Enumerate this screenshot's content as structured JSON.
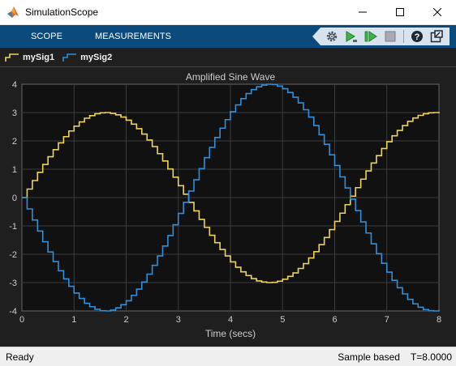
{
  "window": {
    "title": "SimulationScope"
  },
  "toolstrip": {
    "tabs": [
      {
        "label": "SCOPE"
      },
      {
        "label": "MEASUREMENTS"
      }
    ],
    "icons": [
      "settings-icon",
      "step-forward-icon",
      "run-icon",
      "stop-icon",
      "help-icon",
      "undock-icon"
    ]
  },
  "legend": {
    "items": [
      {
        "label": "mySig1",
        "color": "#edd458"
      },
      {
        "label": "mySig2",
        "color": "#2e8fdc"
      }
    ]
  },
  "chart_data": {
    "type": "line",
    "title": "Amplified Sine Wave",
    "xlabel": "Time (secs)",
    "ylabel": "",
    "xlim": [
      0,
      8
    ],
    "ylim": [
      -4,
      4
    ],
    "x_ticks": [
      "0",
      "1",
      "2",
      "3",
      "4",
      "5",
      "6",
      "7",
      "8"
    ],
    "y_ticks": [
      "4",
      "3",
      "2",
      "1",
      "0",
      "-1",
      "-2",
      "-3",
      "-4"
    ],
    "grid": true,
    "step": true,
    "sample_time": 0.1,
    "series": [
      {
        "name": "mySig1",
        "color": "#edd458",
        "x": [
          0,
          0.1,
          0.2,
          0.3,
          0.4,
          0.5,
          0.6,
          0.7,
          0.8,
          0.9,
          1,
          1.1,
          1.2,
          1.3,
          1.4,
          1.5,
          1.6,
          1.7,
          1.8,
          1.9,
          2,
          2.1,
          2.2,
          2.3,
          2.4,
          2.5,
          2.6,
          2.7,
          2.8,
          2.9,
          3,
          3.1,
          3.2,
          3.3,
          3.4,
          3.5,
          3.6,
          3.7,
          3.8,
          3.9,
          4,
          4.1,
          4.2,
          4.3,
          4.4,
          4.5,
          4.6,
          4.7,
          4.8,
          4.9,
          5,
          5.1,
          5.2,
          5.3,
          5.4,
          5.5,
          5.6,
          5.7,
          5.8,
          5.9,
          6,
          6.1,
          6.2,
          6.3,
          6.4,
          6.5,
          6.6,
          6.7,
          6.8,
          6.9,
          7,
          7.1,
          7.2,
          7.3,
          7.4,
          7.5,
          7.6,
          7.7,
          7.8,
          7.9,
          8
        ],
        "y": [
          0,
          0.3,
          0.6,
          0.89,
          1.17,
          1.44,
          1.69,
          1.93,
          2.15,
          2.35,
          2.52,
          2.67,
          2.8,
          2.89,
          2.96,
          2.99,
          3,
          2.97,
          2.92,
          2.84,
          2.73,
          2.59,
          2.43,
          2.24,
          2.03,
          1.8,
          1.55,
          1.29,
          1.01,
          0.72,
          0.42,
          0.12,
          -0.17,
          -0.47,
          -0.77,
          -1.05,
          -1.33,
          -1.59,
          -1.83,
          -2.06,
          -2.27,
          -2.46,
          -2.62,
          -2.75,
          -2.86,
          -2.94,
          -2.98,
          -3,
          -2.99,
          -2.95,
          -2.88,
          -2.78,
          -2.66,
          -2.5,
          -2.33,
          -2.13,
          -1.91,
          -1.66,
          -1.41,
          -1.13,
          -0.84,
          -0.55,
          -0.25,
          0.05,
          0.35,
          0.65,
          0.94,
          1.22,
          1.48,
          1.73,
          1.97,
          2.18,
          2.37,
          2.54,
          2.69,
          2.81,
          2.9,
          2.96,
          2.99,
          3,
          2.97
        ]
      },
      {
        "name": "mySig2",
        "color": "#2e8fdc",
        "x": [
          0,
          0.1,
          0.2,
          0.3,
          0.4,
          0.5,
          0.6,
          0.7,
          0.8,
          0.9,
          1,
          1.1,
          1.2,
          1.3,
          1.4,
          1.5,
          1.6,
          1.7,
          1.8,
          1.9,
          2,
          2.1,
          2.2,
          2.3,
          2.4,
          2.5,
          2.6,
          2.7,
          2.8,
          2.9,
          3,
          3.1,
          3.2,
          3.3,
          3.4,
          3.5,
          3.6,
          3.7,
          3.8,
          3.9,
          4,
          4.1,
          4.2,
          4.3,
          4.4,
          4.5,
          4.6,
          4.7,
          4.8,
          4.9,
          5,
          5.1,
          5.2,
          5.3,
          5.4,
          5.5,
          5.6,
          5.7,
          5.8,
          5.9,
          6,
          6.1,
          6.2,
          6.3,
          6.4,
          6.5,
          6.6,
          6.7,
          6.8,
          6.9,
          7,
          7.1,
          7.2,
          7.3,
          7.4,
          7.5,
          7.6,
          7.7,
          7.8,
          7.9,
          8
        ],
        "y": [
          0,
          -0.4,
          -0.79,
          -1.18,
          -1.56,
          -1.92,
          -2.26,
          -2.58,
          -2.87,
          -3.13,
          -3.37,
          -3.56,
          -3.73,
          -3.85,
          -3.94,
          -3.99,
          -4,
          -3.97,
          -3.89,
          -3.78,
          -3.64,
          -3.45,
          -3.23,
          -2.98,
          -2.7,
          -2.39,
          -2.06,
          -1.71,
          -1.34,
          -0.96,
          -0.56,
          -0.17,
          0.23,
          0.63,
          1.02,
          1.41,
          1.77,
          2.12,
          2.45,
          2.75,
          3.03,
          3.27,
          3.49,
          3.67,
          3.81,
          3.91,
          3.97,
          4,
          3.99,
          3.93,
          3.84,
          3.71,
          3.54,
          3.34,
          3.1,
          2.84,
          2.54,
          2.22,
          1.88,
          1.51,
          1.13,
          0.73,
          0.34,
          -0.06,
          -0.46,
          -0.86,
          -1.25,
          -1.63,
          -1.98,
          -2.32,
          -2.63,
          -2.92,
          -3.18,
          -3.4,
          -3.59,
          -3.75,
          -3.87,
          -3.95,
          -3.99,
          -4,
          -3.96
        ]
      }
    ]
  },
  "status": {
    "left": "Ready",
    "mode": "Sample based",
    "time": "T=8.0000"
  },
  "colors": {
    "toolstrip_bg": "#0b4a7c",
    "plot_bg": "#111111",
    "figure_bg": "#1f1f1f",
    "grid": "#3b3b3b",
    "axis_text": "#cccccc"
  }
}
